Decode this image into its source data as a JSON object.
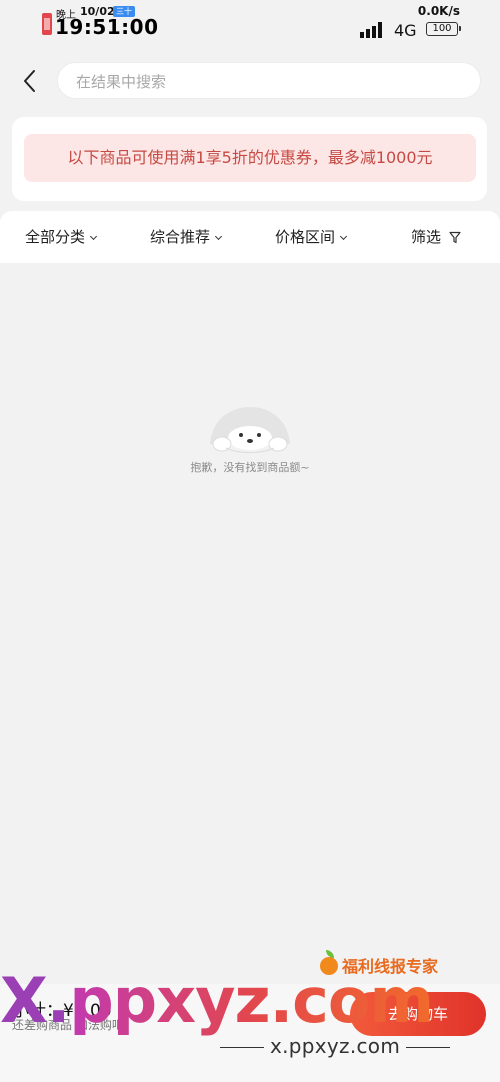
{
  "status_bar": {
    "ampm": "晚上",
    "date": "10/02",
    "lunar": "三十",
    "time": "19:51:00",
    "net_speed": "0.0K/s",
    "network": "4G",
    "battery": "100"
  },
  "search": {
    "placeholder": "在结果中搜索"
  },
  "coupon": {
    "text": "以下商品可使用满1享5折的优惠券，最多减1000元"
  },
  "filters": {
    "category": "全部分类",
    "sort": "综合推荐",
    "price": "价格区间",
    "filter": "筛选"
  },
  "empty_state": {
    "message": "抱歉，没有找到商品额~"
  },
  "bottom": {
    "total_label": "小计：¥0.00",
    "total_note": "还差购商品 加法购吧！",
    "cart_button": "去购物车"
  },
  "watermark": {
    "brand": "福利线报专家",
    "big_text_a": "X.",
    "big_text_b": "ppxyz.com",
    "url": "x.ppxyz.com"
  },
  "colors": {
    "accent": "#c64a43",
    "coupon_bg": "#fde6e6",
    "page_bg": "#f2f2f2"
  }
}
